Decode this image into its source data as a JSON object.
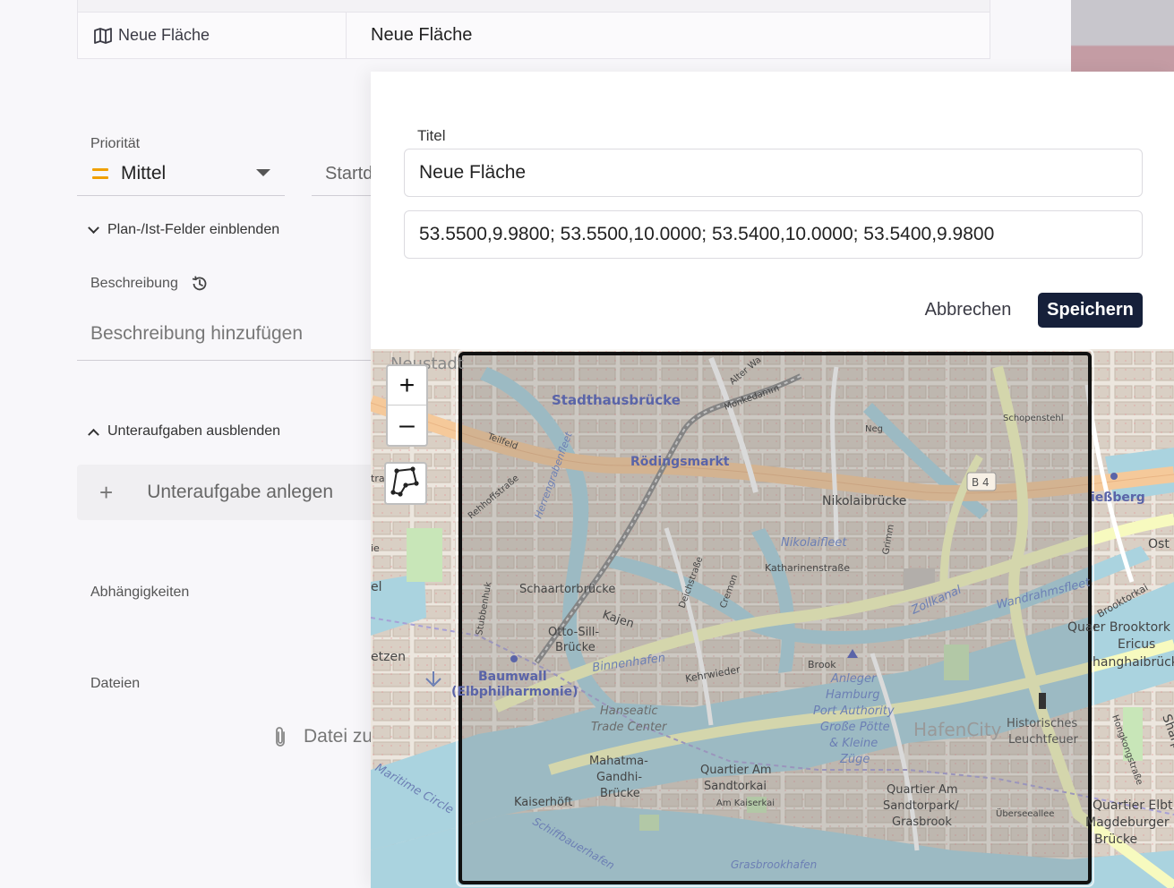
{
  "top_row": {
    "label": "Neue Fläche",
    "value": "Neue Fläche"
  },
  "form": {
    "priority_label": "Priorität",
    "priority_value": "Mittel",
    "start_label": "Startd",
    "plan_toggle": "Plan-/Ist-Felder einblenden",
    "description_label": "Beschreibung",
    "description_placeholder": "Beschreibung hinzufügen",
    "subtasks_toggle": "Unteraufgaben ausblenden",
    "subtask_add": "Unteraufgabe anlegen",
    "dependencies_label": "Abhängigkeiten",
    "files_label": "Dateien",
    "file_add": "Datei zu"
  },
  "dialog": {
    "title_label": "Titel",
    "title_value": "Neue Fläche",
    "coordinates_value": "53.5500,9.9800; 53.5500,10.0000; 53.5400,10.0000; 53.5400,9.9800",
    "cancel_label": "Abbrechen",
    "save_label": "Speichern"
  },
  "map": {
    "zoom_in": "+",
    "zoom_out": "–",
    "labels": {
      "neustadt": "Neustadt",
      "stadthausbruecke": "Stadthausbrücke",
      "roedingsmarkt": "Rödingsmarkt",
      "nikolaibruecke": "Nikolaibrücke",
      "nikolaifleet": "Nikolaifleet",
      "katharinenstrasse": "Katharinenstraße",
      "schaartorbruecke": "Schaartorbrücke",
      "otto_sill": "Otto-Sill-",
      "bruecke": "Brücke",
      "kajen": "Kajen",
      "binnenhafen": "Binnenhafen",
      "baumwall": "Baumwall",
      "elbphilharmonie": "(Elbphilharmonie)",
      "kehrwieder": "Kehrwieder",
      "hanseatic": "Hanseatic",
      "trade_center": "Trade Center",
      "brook": "Brook",
      "anleger": "Anleger",
      "hamburg": "Hamburg",
      "port_authority": "Port Authority",
      "grosse_pötte": "Große Pötte",
      "kleine": "& Kleine",
      "zuege": "Züge",
      "hafencity": "HafenCity",
      "historisches": "Historisches",
      "leuchtfeuer": "Leuchtfeuer",
      "mahatma": "Mahatma-",
      "gandhi": "Gandhi-",
      "kaiserhoeft": "Kaiserhöft",
      "quartier_am": "Quartier Am",
      "sandtorkai": "Sandtorkai",
      "am_kaiserkai": "Am Kaiserkai",
      "quartier_am2": "Quartier Am",
      "sandtorpark": "Sandtorpark/",
      "grasbrook": "Grasbrook",
      "ueberseeallee": "Überseeallee",
      "grasbrookhafen": "Grasbrookhafen",
      "schopenstehl": "Schopenstehl",
      "b4": "B 4",
      "zollkanal": "Zollkanal",
      "wandrahmsfleet": "Wandrahmsfleet",
      "ost": "Ost",
      "quartier_elbt": "Quartier Elbt",
      "magdeburger": "Magdeburger",
      "bruecke2": "Brücke",
      "brooktorkai": "Brooktorkai",
      "ericus": "Ericus",
      "hanghaibruecke": "hanghaibrück",
      "ober_brooktor": "er Brooktork",
      "wiesberg": "ießberg",
      "maritime_circle": "Maritime Circle",
      "schiffbauerhafen": "Schiffbauerhafen",
      "teilfeld": "Teilfeld",
      "rehhoffstrasse": "Rehhoffstraße",
      "herrengrabenfleet": "Herrengrabenfleet",
      "deichstrasse": "Deichstraße",
      "cremon": "Cremon",
      "grimm": "Grimm",
      "monkedamm": "Monkedamm",
      "alter_wall": "Alter Wa",
      "stubbenhuk": "Stubbenhuk",
      "neg": "Neg",
      "quart": "Quar",
      "hongkongstrasse": "Hongkongstraße",
      "sharp": "Sharp",
      "etzen": "etzen",
      "el": "el",
      "tra": "tra",
      "ie": "ie"
    }
  }
}
